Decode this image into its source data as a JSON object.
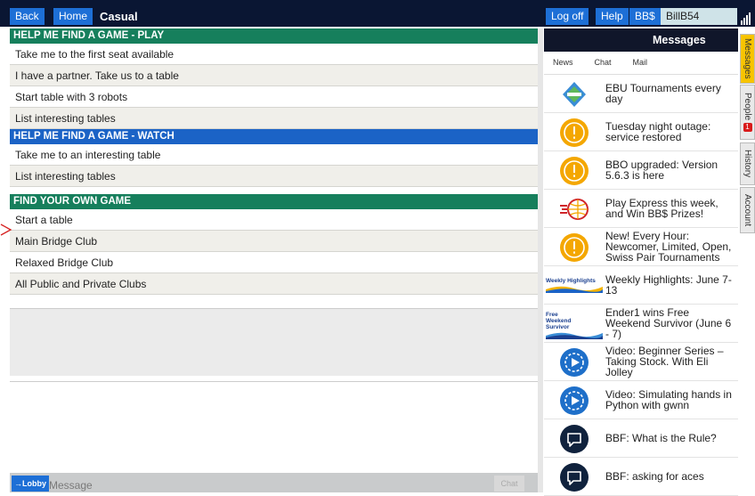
{
  "topbar": {
    "back": "Back",
    "home": "Home",
    "title": "Casual",
    "logoff": "Log off",
    "help": "Help",
    "bbd": "BB$",
    "username": "BillB54"
  },
  "play": {
    "header": "HELP ME FIND A GAME - PLAY",
    "items": [
      "Take me to the first seat available",
      "I have a partner. Take us to a table",
      "Start table with 3 robots",
      "List interesting tables"
    ]
  },
  "watch": {
    "header": "HELP ME FIND A GAME - WATCH",
    "items": [
      "Take me to an interesting table",
      "List interesting tables"
    ]
  },
  "own": {
    "header": "FIND YOUR OWN GAME",
    "items": [
      "Start a table",
      "Main Bridge Club",
      "Relaxed Bridge Club",
      "All Public and Private Clubs"
    ]
  },
  "chat": {
    "lobby": "→Lobby",
    "placeholder": "Message",
    "send": "Chat"
  },
  "messages": {
    "title": "Messages",
    "tabs": [
      "News",
      "Chat",
      "Mail"
    ],
    "items": [
      {
        "icon": "ebu-logo-icon",
        "text": "EBU Tournaments every day"
      },
      {
        "icon": "alert-icon",
        "text": "Tuesday night outage: service restored"
      },
      {
        "icon": "alert-icon",
        "text": "BBO upgraded: Version 5.6.3 is here"
      },
      {
        "icon": "express-globe-icon",
        "text": "Play Express this week, and Win BB$ Prizes!"
      },
      {
        "icon": "alert-icon",
        "text": "New! Every Hour: Newcomer, Limited, Open, Swiss Pair Tournaments"
      },
      {
        "icon": "weekly-highlights-banner",
        "banner": "Weekly Highlights",
        "text": "Weekly Highlights: June 7-13"
      },
      {
        "icon": "free-weekend-banner",
        "banner": "Free Weekend Survivor",
        "text": "Ender1 wins Free Weekend Survivor (June 6 - 7)"
      },
      {
        "icon": "video-icon",
        "text": "Video: Beginner Series – Taking Stock. With Eli Jolley"
      },
      {
        "icon": "video-icon",
        "text": "Video: Simulating hands in Python with gwnn"
      },
      {
        "icon": "chat-bubble-icon",
        "text": "BBF: What is the Rule?"
      },
      {
        "icon": "chat-bubble-icon",
        "text": "BBF: asking for aces"
      }
    ]
  },
  "sidetabs": {
    "messages": "Messages",
    "people": "People",
    "people_badge": "1",
    "history": "History",
    "account": "Account"
  },
  "colors": {
    "topbar": "#0a1633",
    "button": "#1d6fd6",
    "play_header": "#167f5c",
    "watch_header": "#1b63c6",
    "alert": "#f4a700",
    "active_tab": "#f7c400"
  }
}
